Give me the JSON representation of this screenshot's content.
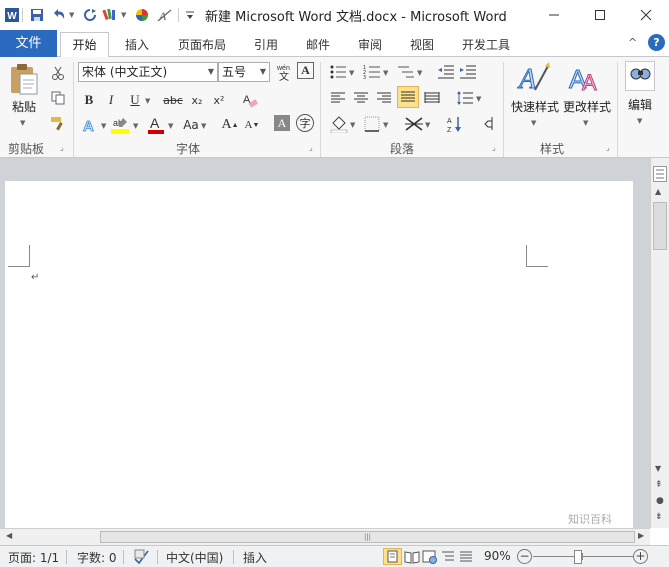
{
  "window": {
    "title": "新建 Microsoft Word 文档.docx - Microsoft Word",
    "app_icon": "word-icon",
    "controls": [
      "minimize-icon",
      "maximize-icon",
      "close-icon"
    ]
  },
  "quick_access": {
    "items": [
      "save-icon",
      "undo-icon",
      "redo-icon",
      "format-painter-icon",
      "color-wheel-icon",
      "clear-format-icon",
      "customize-icon"
    ]
  },
  "tabs": {
    "file": "文件",
    "items": [
      "开始",
      "插入",
      "页面布局",
      "引用",
      "邮件",
      "审阅",
      "视图",
      "开发工具"
    ],
    "active": "开始"
  },
  "ribbon": {
    "clipboard": {
      "paste": "粘贴",
      "label": "剪贴板"
    },
    "font": {
      "label": "字体",
      "font_name": "宋体 (中文正文)",
      "font_size": "五号",
      "bold": "B",
      "italic": "I",
      "underline": "U",
      "strike": "abc",
      "subscript": "x₂",
      "superscript": "x²",
      "change_case": "Aa",
      "grow": "A",
      "shrink": "A",
      "font_color_hex": "#d00000",
      "highlight_hex": "#ffff00"
    },
    "paragraph": {
      "label": "段落"
    },
    "styles": {
      "quick": "快速样式",
      "change": "更改样式",
      "label": "样式"
    },
    "editing": {
      "label": "编辑"
    }
  },
  "document": {
    "paragraph_mark": "↵"
  },
  "status": {
    "page": "页面: 1/1",
    "words": "字数: 0",
    "language": "中文(中国)",
    "mode": "插入",
    "zoom": "90%"
  },
  "colors": {
    "accent": "#2b6bbf",
    "ribbon_bg": "#f7f7f7",
    "doc_bg": "#cfd3d8"
  },
  "watermark": {
    "text": "知识百科"
  }
}
